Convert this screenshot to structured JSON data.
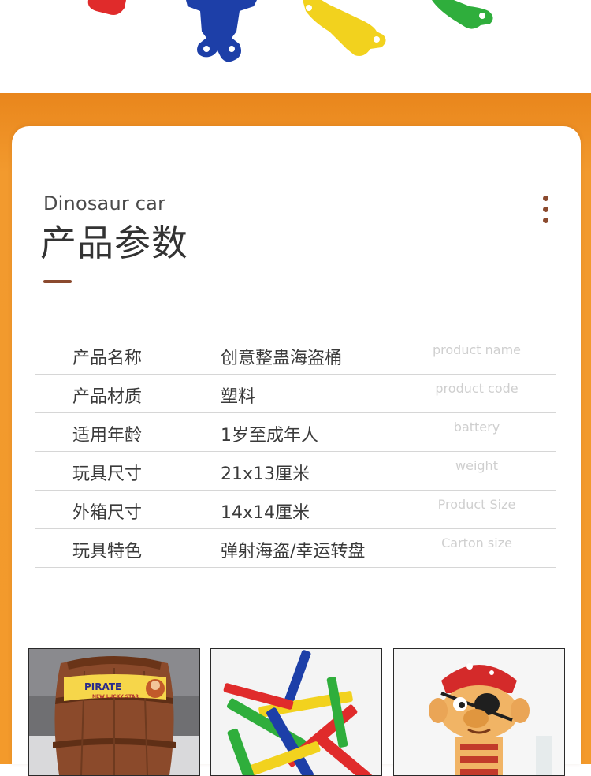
{
  "section": {
    "subtitle": "Dinosaur car",
    "title": "产品参数"
  },
  "specs": [
    {
      "label": "产品名称",
      "value": "创意整蛊海盗桶",
      "en": "product name"
    },
    {
      "label": "产品材质",
      "value": "塑料",
      "en": "product code"
    },
    {
      "label": "适用年龄",
      "value": "1岁至成年人",
      "en": "battery"
    },
    {
      "label": "玩具尺寸",
      "value": "21x13厘米",
      "en": "weight"
    },
    {
      "label": "外箱尺寸",
      "value": "14x14厘米",
      "en": "Product Size"
    },
    {
      "label": "玩具特色",
      "value": "弹射海盗/幸运转盘",
      "en": "Carton size"
    }
  ],
  "photos": {
    "barrel_label_main": "PIRATE",
    "barrel_label_sub": "NEW LUCKY STAR"
  },
  "colors": {
    "orange": "#f39a2b",
    "accent_brown": "#8b4a2e",
    "sword_red": "#e02b2b",
    "sword_blue": "#1d3fa8",
    "sword_yellow": "#f2d21e",
    "sword_green": "#2fae3c"
  }
}
